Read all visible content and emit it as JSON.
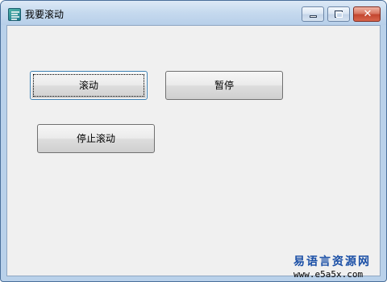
{
  "window": {
    "title": "我要滚动",
    "icon": "app-logo-icon",
    "controls": {
      "minimize": "minimize-icon",
      "maximize": "maximize-icon",
      "close": "close-icon",
      "close_glyph": "✕"
    }
  },
  "buttons": {
    "scroll_label": "滚动",
    "pause_label": "暂停",
    "stop_label": "停止滚动"
  },
  "watermark": {
    "name": "易语言资源网",
    "url": "www.e5a5x.com"
  },
  "colors": {
    "titlebar": "#c5d9ee",
    "client_bg": "#f0f0f0",
    "close_button": "#c3462f",
    "watermark_text": "#1a4fa6"
  }
}
